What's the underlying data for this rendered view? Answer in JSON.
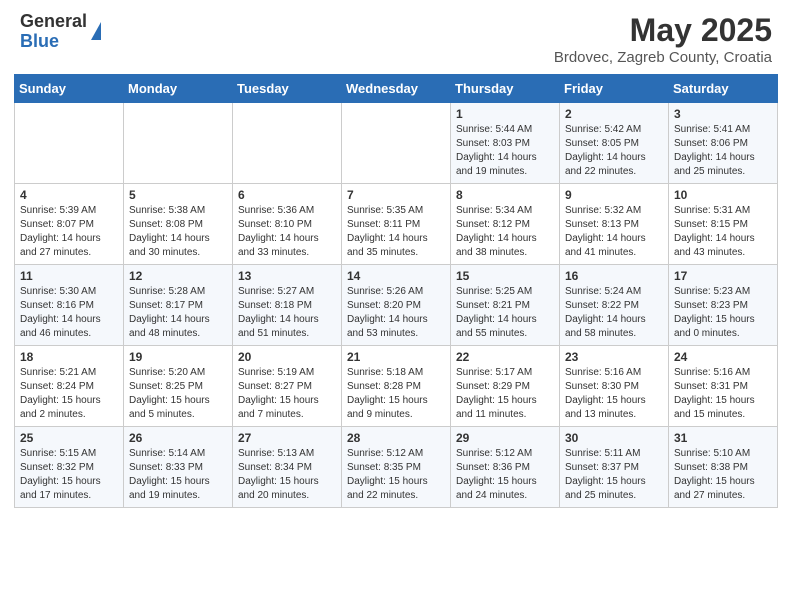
{
  "header": {
    "logo_general": "General",
    "logo_blue": "Blue",
    "title": "May 2025",
    "subtitle": "Brdovec, Zagreb County, Croatia"
  },
  "days_of_week": [
    "Sunday",
    "Monday",
    "Tuesday",
    "Wednesday",
    "Thursday",
    "Friday",
    "Saturday"
  ],
  "weeks": [
    [
      {
        "num": "",
        "info": ""
      },
      {
        "num": "",
        "info": ""
      },
      {
        "num": "",
        "info": ""
      },
      {
        "num": "",
        "info": ""
      },
      {
        "num": "1",
        "info": "Sunrise: 5:44 AM\nSunset: 8:03 PM\nDaylight: 14 hours\nand 19 minutes."
      },
      {
        "num": "2",
        "info": "Sunrise: 5:42 AM\nSunset: 8:05 PM\nDaylight: 14 hours\nand 22 minutes."
      },
      {
        "num": "3",
        "info": "Sunrise: 5:41 AM\nSunset: 8:06 PM\nDaylight: 14 hours\nand 25 minutes."
      }
    ],
    [
      {
        "num": "4",
        "info": "Sunrise: 5:39 AM\nSunset: 8:07 PM\nDaylight: 14 hours\nand 27 minutes."
      },
      {
        "num": "5",
        "info": "Sunrise: 5:38 AM\nSunset: 8:08 PM\nDaylight: 14 hours\nand 30 minutes."
      },
      {
        "num": "6",
        "info": "Sunrise: 5:36 AM\nSunset: 8:10 PM\nDaylight: 14 hours\nand 33 minutes."
      },
      {
        "num": "7",
        "info": "Sunrise: 5:35 AM\nSunset: 8:11 PM\nDaylight: 14 hours\nand 35 minutes."
      },
      {
        "num": "8",
        "info": "Sunrise: 5:34 AM\nSunset: 8:12 PM\nDaylight: 14 hours\nand 38 minutes."
      },
      {
        "num": "9",
        "info": "Sunrise: 5:32 AM\nSunset: 8:13 PM\nDaylight: 14 hours\nand 41 minutes."
      },
      {
        "num": "10",
        "info": "Sunrise: 5:31 AM\nSunset: 8:15 PM\nDaylight: 14 hours\nand 43 minutes."
      }
    ],
    [
      {
        "num": "11",
        "info": "Sunrise: 5:30 AM\nSunset: 8:16 PM\nDaylight: 14 hours\nand 46 minutes."
      },
      {
        "num": "12",
        "info": "Sunrise: 5:28 AM\nSunset: 8:17 PM\nDaylight: 14 hours\nand 48 minutes."
      },
      {
        "num": "13",
        "info": "Sunrise: 5:27 AM\nSunset: 8:18 PM\nDaylight: 14 hours\nand 51 minutes."
      },
      {
        "num": "14",
        "info": "Sunrise: 5:26 AM\nSunset: 8:20 PM\nDaylight: 14 hours\nand 53 minutes."
      },
      {
        "num": "15",
        "info": "Sunrise: 5:25 AM\nSunset: 8:21 PM\nDaylight: 14 hours\nand 55 minutes."
      },
      {
        "num": "16",
        "info": "Sunrise: 5:24 AM\nSunset: 8:22 PM\nDaylight: 14 hours\nand 58 minutes."
      },
      {
        "num": "17",
        "info": "Sunrise: 5:23 AM\nSunset: 8:23 PM\nDaylight: 15 hours\nand 0 minutes."
      }
    ],
    [
      {
        "num": "18",
        "info": "Sunrise: 5:21 AM\nSunset: 8:24 PM\nDaylight: 15 hours\nand 2 minutes."
      },
      {
        "num": "19",
        "info": "Sunrise: 5:20 AM\nSunset: 8:25 PM\nDaylight: 15 hours\nand 5 minutes."
      },
      {
        "num": "20",
        "info": "Sunrise: 5:19 AM\nSunset: 8:27 PM\nDaylight: 15 hours\nand 7 minutes."
      },
      {
        "num": "21",
        "info": "Sunrise: 5:18 AM\nSunset: 8:28 PM\nDaylight: 15 hours\nand 9 minutes."
      },
      {
        "num": "22",
        "info": "Sunrise: 5:17 AM\nSunset: 8:29 PM\nDaylight: 15 hours\nand 11 minutes."
      },
      {
        "num": "23",
        "info": "Sunrise: 5:16 AM\nSunset: 8:30 PM\nDaylight: 15 hours\nand 13 minutes."
      },
      {
        "num": "24",
        "info": "Sunrise: 5:16 AM\nSunset: 8:31 PM\nDaylight: 15 hours\nand 15 minutes."
      }
    ],
    [
      {
        "num": "25",
        "info": "Sunrise: 5:15 AM\nSunset: 8:32 PM\nDaylight: 15 hours\nand 17 minutes."
      },
      {
        "num": "26",
        "info": "Sunrise: 5:14 AM\nSunset: 8:33 PM\nDaylight: 15 hours\nand 19 minutes."
      },
      {
        "num": "27",
        "info": "Sunrise: 5:13 AM\nSunset: 8:34 PM\nDaylight: 15 hours\nand 20 minutes."
      },
      {
        "num": "28",
        "info": "Sunrise: 5:12 AM\nSunset: 8:35 PM\nDaylight: 15 hours\nand 22 minutes."
      },
      {
        "num": "29",
        "info": "Sunrise: 5:12 AM\nSunset: 8:36 PM\nDaylight: 15 hours\nand 24 minutes."
      },
      {
        "num": "30",
        "info": "Sunrise: 5:11 AM\nSunset: 8:37 PM\nDaylight: 15 hours\nand 25 minutes."
      },
      {
        "num": "31",
        "info": "Sunrise: 5:10 AM\nSunset: 8:38 PM\nDaylight: 15 hours\nand 27 minutes."
      }
    ]
  ]
}
